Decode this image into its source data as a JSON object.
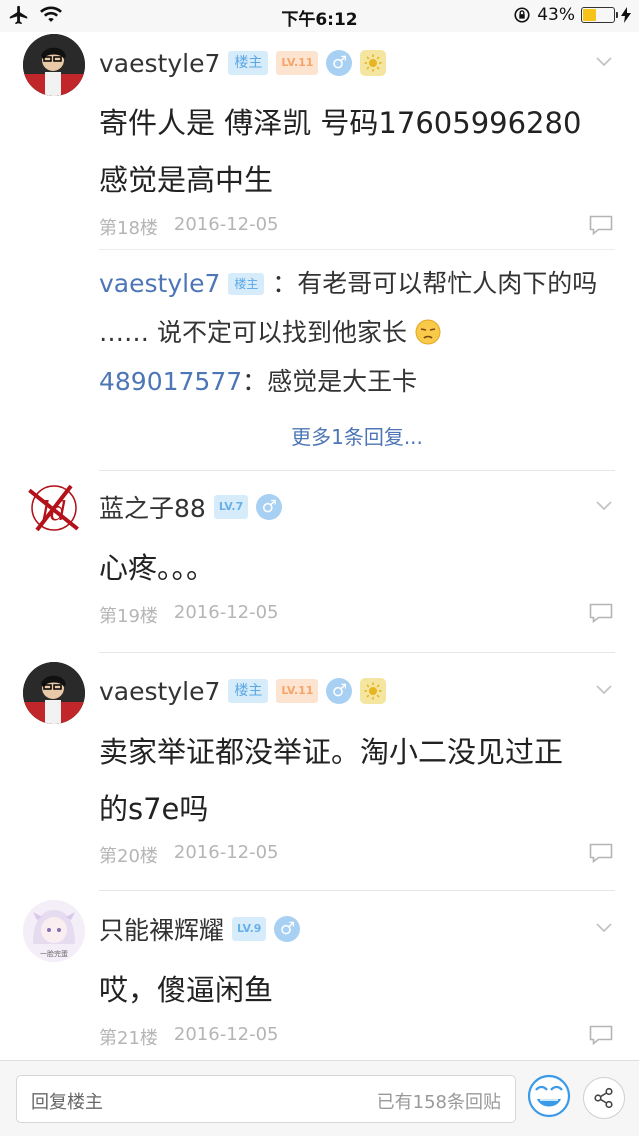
{
  "status_bar": {
    "time": "下午6:12",
    "battery": "43%",
    "battery_level": 0.43
  },
  "posts": [
    {
      "username": "vaestyle7",
      "owner_badge": "楼主",
      "level": "LV.11",
      "gender": "♂",
      "text_lines": [
        "寄件人是 傅泽凯 号码17605996280",
        "感觉是高中生"
      ],
      "floor": "第18楼",
      "date": "2016-12-05",
      "replies": [
        {
          "user": "vaestyle7",
          "badge": "楼主",
          "text": "：有老哥可以帮忙人肉下的吗",
          "text2": "…… 说不定可以找到他家长"
        },
        {
          "user": "489017577",
          "text": "：感觉是大王卡"
        }
      ],
      "more_replies": "更多1条回复..."
    },
    {
      "username": "蓝之子88",
      "level": "LV.7",
      "gender": "♂",
      "text_lines": [
        "心疼。。。"
      ],
      "floor": "第19楼",
      "date": "2016-12-05"
    },
    {
      "username": "vaestyle7",
      "owner_badge": "楼主",
      "level": "LV.11",
      "gender": "♂",
      "text_lines": [
        "卖家举证都没举证。淘小二没见过正",
        "的s7e吗"
      ],
      "floor": "第20楼",
      "date": "2016-12-05"
    },
    {
      "username": "只能裸辉耀",
      "level": "LV.9",
      "gender": "♂",
      "text_lines": [
        "哎，傻逼闲鱼"
      ],
      "floor": "第21楼",
      "date": "2016-12-05"
    }
  ],
  "bottom_bar": {
    "placeholder": "回复楼主",
    "reply_count": "已有158条回贴"
  },
  "icons": [
    "airplane-icon",
    "wifi-icon",
    "rotation-lock-icon",
    "charging-icon",
    "chevron-down-icon",
    "comment-icon",
    "emoji-icon",
    "share-icon"
  ],
  "colors": {
    "link_blue": "#4e76b6",
    "meta_gray": "#b5b5b5",
    "battery": "#f6c31a"
  }
}
